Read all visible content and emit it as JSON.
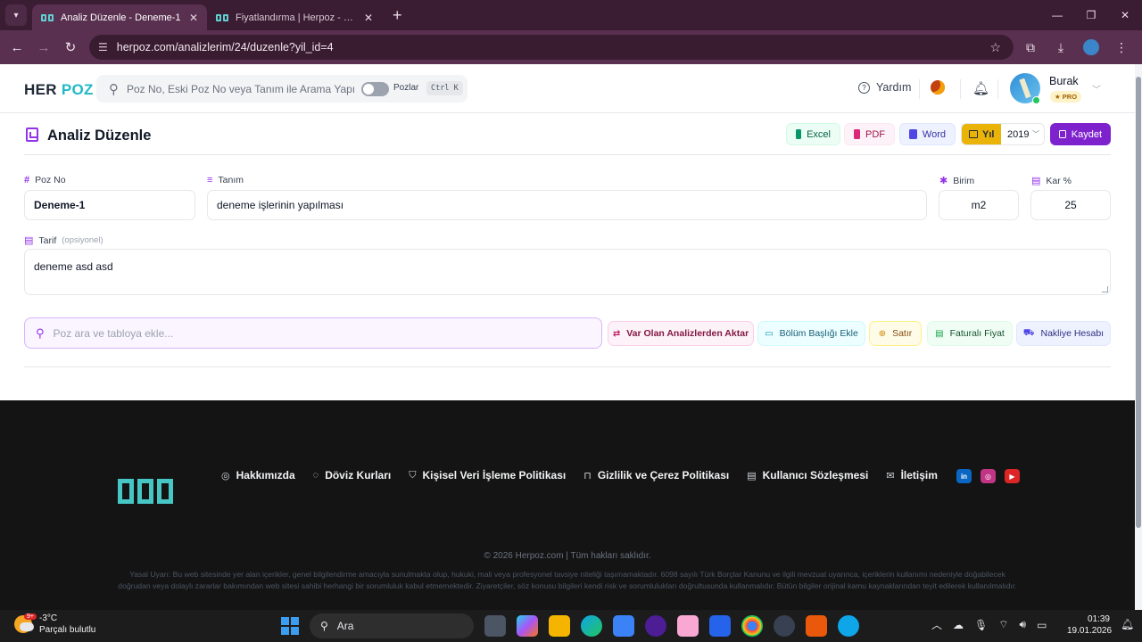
{
  "browser": {
    "tabs": [
      {
        "title": "Analiz Düzenle - Deneme-1",
        "active": true
      },
      {
        "title": "Fiyatlandırma | Herpoz - Birim F",
        "active": false
      }
    ],
    "url": "herpoz.com/analizlerim/24/duzenle?yil_id=4"
  },
  "header": {
    "logo_part1": "HER",
    "logo_part2": "POZ",
    "search_placeholder": "Poz No, Eski Poz No veya Tanım ile Arama Yapı",
    "toggle_label": "Pozlar",
    "shortcut": "Ctrl K",
    "help_label": "Yardım",
    "user_name": "Burak",
    "user_badge": "★ PRO"
  },
  "page": {
    "title": "Analiz Düzenle",
    "toolbar": {
      "excel": "Excel",
      "pdf": "PDF",
      "word": "Word",
      "year_label": "Yıl",
      "year_value": "2019",
      "save": "Kaydet"
    },
    "form": {
      "poz_no_label": "Poz No",
      "poz_no_value": "Deneme-1",
      "tanim_label": "Tanım",
      "tanim_value": "deneme işlerinin yapılması",
      "birim_label": "Birim",
      "birim_value": "m2",
      "kar_label": "Kar %",
      "kar_value": "25",
      "tarif_label": "Tarif",
      "tarif_optional": "(opsiyonel)",
      "tarif_value": "deneme asd asd"
    },
    "poz_search_placeholder": "Poz ara ve tabloya ekle...",
    "actions": {
      "transfer": "Var Olan Analizlerden Aktar",
      "section_header": "Bölüm Başlığı Ekle",
      "row": "Satır",
      "invoiced_price": "Faturalı Fiyat",
      "shipping": "Nakliye Hesabı"
    }
  },
  "footer": {
    "links": [
      {
        "icon": "info-icon",
        "label": "Hakkımızda"
      },
      {
        "icon": "currency-icon",
        "label": "Döviz Kurları"
      },
      {
        "icon": "shield-icon",
        "label": "Kişisel Veri İşleme Politikası"
      },
      {
        "icon": "lock-icon",
        "label": "Gizlilik ve Çerez Politikası"
      },
      {
        "icon": "document-icon",
        "label": "Kullanıcı Sözleşmesi"
      },
      {
        "icon": "mail-icon",
        "label": "İletişim"
      }
    ],
    "copyright": "© 2026 Herpoz.com | Tüm hakları saklıdır.",
    "legal": "Yasal Uyarı: Bu web sitesinde yer alan içerikler, genel bilgilendirme amacıyla sunulmakta olup, hukuki, mali veya profesyonel tavsiye niteliği taşımamaktadır. 6098 sayılı Türk Borçlar Kanunu ve ilgili mevzuat uyarınca, içeriklerin kullanımı nedeniyle doğabilecek doğrudan veya dolaylı zararlar bakımından web sitesi sahibi herhangi bir sorumluluk kabul etmemektedir. Ziyaretçiler, söz konusu bilgileri kendi risk ve sorumlulukları doğrultusunda kullanmalıdır. Bütün bilgiler orijinal kamu kaynaklarından teyit edilerek kullanılmalıdır."
  },
  "taskbar": {
    "temperature": "-3°C",
    "weather": "Parçalı bulutlu",
    "weather_badge": "9+",
    "search_label": "Ara",
    "time": "01:39",
    "date": "19.01.2026"
  },
  "colors": {
    "accent": "#7e22ce",
    "brand_teal": "#22b8c8",
    "footer_bg": "#141414"
  }
}
